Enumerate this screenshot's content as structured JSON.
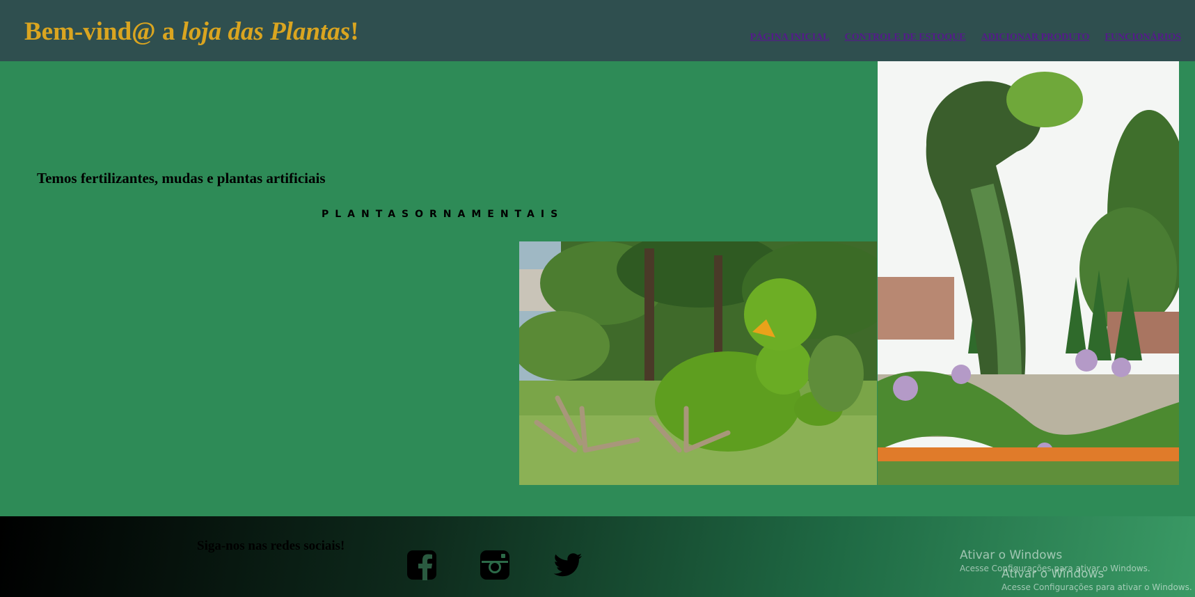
{
  "header": {
    "title_prefix": "Bem-vind@ a ",
    "title_emphasis": "loja das Plantas",
    "title_suffix": "!",
    "nav": [
      {
        "label": "PÁGINA INICIAL"
      },
      {
        "label": "CONTROLE DE ESTOQUE"
      },
      {
        "label": "ADICIONAR PRODUTO"
      },
      {
        "label": "FUNCIONÁRIOS"
      }
    ]
  },
  "main": {
    "intro_text": "Temos fertilizantes, mudas e plantas artificiais",
    "ornamental_label": "PLANTASORNAMENTAIS",
    "images": [
      {
        "icon": "topiary-bird-photo"
      },
      {
        "icon": "topiary-cobra-photo"
      }
    ]
  },
  "footer": {
    "follow_text": "Siga-nos nas redes sociais!",
    "social": [
      {
        "icon": "facebook-icon"
      },
      {
        "icon": "instagram-icon"
      },
      {
        "icon": "twitter-icon"
      }
    ]
  },
  "watermark": {
    "title": "Ativar o Windows",
    "subtitle": "Acesse Configurações para ativar o Windows."
  },
  "colors": {
    "header_bg": "#2f4f4f",
    "main_bg": "#2e8b57",
    "brand": "#daa520",
    "nav_link": "#551a8b"
  }
}
